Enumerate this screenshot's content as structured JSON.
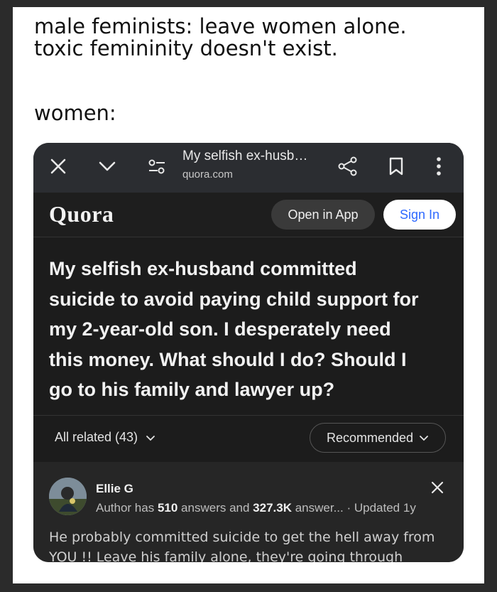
{
  "meme": {
    "caption_line1": "male feminists: leave women alone.",
    "caption_line2": "toxic femininity doesn't exist.",
    "women_label": "women:"
  },
  "browser": {
    "page_title": "My selfish ex-husb…",
    "domain": "quora.com",
    "icons": [
      "close-icon",
      "chevron-down-icon",
      "site-settings-icon",
      "share-icon",
      "bookmark-icon",
      "more-vert-icon"
    ]
  },
  "quora": {
    "logo": "Quora",
    "open_in_app": "Open in App",
    "sign_in": "Sign In",
    "accent": "#2e69ff",
    "question_lines": [
      "My selfish ex-husband committed",
      "suicide to avoid paying child support for",
      "my 2-year-old son. I desperately need",
      "this money. What should I do? Should I",
      "go to his family and lawyer up?"
    ],
    "all_related": "All related (43)",
    "sort_label": "Recommended"
  },
  "answer": {
    "author": "Ellie G",
    "meta_prefix": "Author has ",
    "answers_count": "510",
    "meta_mid": " answers and ",
    "views_count": "327.3K",
    "meta_suffix": " answer... · Updated 1y",
    "text": "He probably committed suicide to get the hell away from YOU !! Leave his family alone, they're going through"
  }
}
